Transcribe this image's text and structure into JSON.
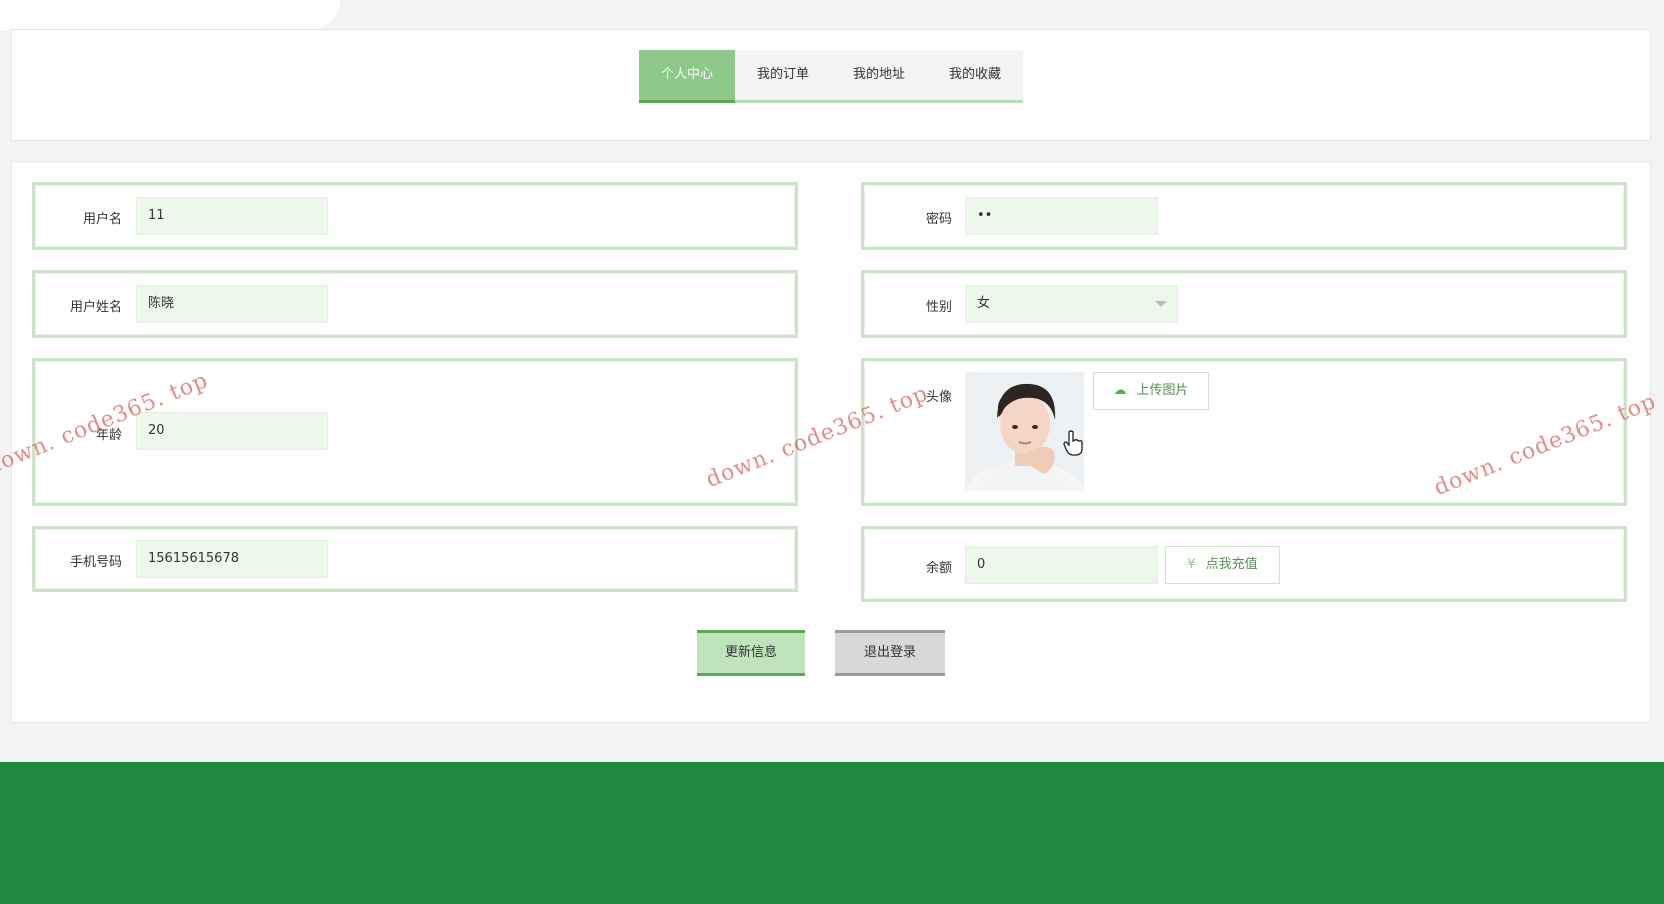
{
  "tabs": [
    {
      "label": "个人中心",
      "active": true
    },
    {
      "label": "我的订单",
      "active": false
    },
    {
      "label": "我的地址",
      "active": false
    },
    {
      "label": "我的收藏",
      "active": false
    }
  ],
  "form": {
    "username": {
      "label": "用户名",
      "value": "11"
    },
    "password": {
      "label": "密码",
      "value": "••"
    },
    "realname": {
      "label": "用户姓名",
      "value": "陈晓"
    },
    "gender": {
      "label": "性别",
      "value": "女"
    },
    "age": {
      "label": "年龄",
      "value": "20"
    },
    "avatar": {
      "label": "头像",
      "upload_label": "上传图片"
    },
    "phone": {
      "label": "手机号码",
      "value": "15615615678"
    },
    "balance": {
      "label": "余额",
      "value": "0",
      "recharge_label": "点我充值"
    }
  },
  "actions": {
    "update_label": "更新信息",
    "logout_label": "退出登录"
  },
  "watermark": {
    "text": "down. code365. top"
  },
  "colors": {
    "accent": "#8ec88a",
    "accent_dark": "#5aa957",
    "field_border": "#cde4cb",
    "input_bg": "#eef7ec",
    "footer": "#1f8a3f"
  },
  "icons": {
    "upload": "cloud-upload-icon",
    "recharge": "yen-coin-icon",
    "caret": "caret-down-icon"
  }
}
